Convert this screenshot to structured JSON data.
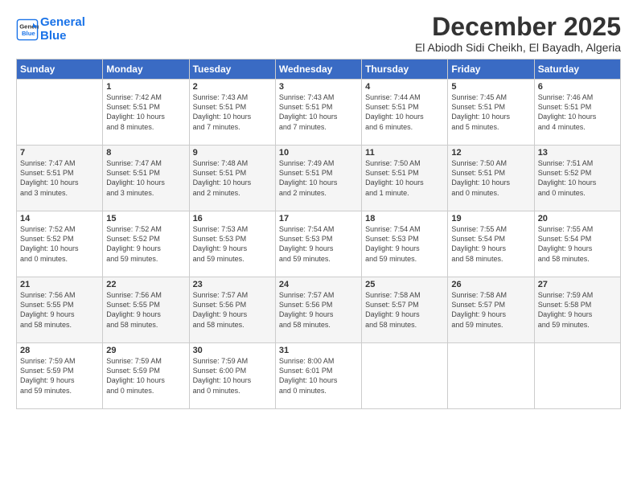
{
  "header": {
    "logo_line1": "General",
    "logo_line2": "Blue",
    "month_title": "December 2025",
    "location": "El Abiodh Sidi Cheikh, El Bayadh, Algeria"
  },
  "weekdays": [
    "Sunday",
    "Monday",
    "Tuesday",
    "Wednesday",
    "Thursday",
    "Friday",
    "Saturday"
  ],
  "weeks": [
    [
      {
        "day": "",
        "info": ""
      },
      {
        "day": "1",
        "info": "Sunrise: 7:42 AM\nSunset: 5:51 PM\nDaylight: 10 hours\nand 8 minutes."
      },
      {
        "day": "2",
        "info": "Sunrise: 7:43 AM\nSunset: 5:51 PM\nDaylight: 10 hours\nand 7 minutes."
      },
      {
        "day": "3",
        "info": "Sunrise: 7:43 AM\nSunset: 5:51 PM\nDaylight: 10 hours\nand 7 minutes."
      },
      {
        "day": "4",
        "info": "Sunrise: 7:44 AM\nSunset: 5:51 PM\nDaylight: 10 hours\nand 6 minutes."
      },
      {
        "day": "5",
        "info": "Sunrise: 7:45 AM\nSunset: 5:51 PM\nDaylight: 10 hours\nand 5 minutes."
      },
      {
        "day": "6",
        "info": "Sunrise: 7:46 AM\nSunset: 5:51 PM\nDaylight: 10 hours\nand 4 minutes."
      }
    ],
    [
      {
        "day": "7",
        "info": "Sunrise: 7:47 AM\nSunset: 5:51 PM\nDaylight: 10 hours\nand 3 minutes."
      },
      {
        "day": "8",
        "info": "Sunrise: 7:47 AM\nSunset: 5:51 PM\nDaylight: 10 hours\nand 3 minutes."
      },
      {
        "day": "9",
        "info": "Sunrise: 7:48 AM\nSunset: 5:51 PM\nDaylight: 10 hours\nand 2 minutes."
      },
      {
        "day": "10",
        "info": "Sunrise: 7:49 AM\nSunset: 5:51 PM\nDaylight: 10 hours\nand 2 minutes."
      },
      {
        "day": "11",
        "info": "Sunrise: 7:50 AM\nSunset: 5:51 PM\nDaylight: 10 hours\nand 1 minute."
      },
      {
        "day": "12",
        "info": "Sunrise: 7:50 AM\nSunset: 5:51 PM\nDaylight: 10 hours\nand 0 minutes."
      },
      {
        "day": "13",
        "info": "Sunrise: 7:51 AM\nSunset: 5:52 PM\nDaylight: 10 hours\nand 0 minutes."
      }
    ],
    [
      {
        "day": "14",
        "info": "Sunrise: 7:52 AM\nSunset: 5:52 PM\nDaylight: 10 hours\nand 0 minutes."
      },
      {
        "day": "15",
        "info": "Sunrise: 7:52 AM\nSunset: 5:52 PM\nDaylight: 9 hours\nand 59 minutes."
      },
      {
        "day": "16",
        "info": "Sunrise: 7:53 AM\nSunset: 5:53 PM\nDaylight: 9 hours\nand 59 minutes."
      },
      {
        "day": "17",
        "info": "Sunrise: 7:54 AM\nSunset: 5:53 PM\nDaylight: 9 hours\nand 59 minutes."
      },
      {
        "day": "18",
        "info": "Sunrise: 7:54 AM\nSunset: 5:53 PM\nDaylight: 9 hours\nand 59 minutes."
      },
      {
        "day": "19",
        "info": "Sunrise: 7:55 AM\nSunset: 5:54 PM\nDaylight: 9 hours\nand 58 minutes."
      },
      {
        "day": "20",
        "info": "Sunrise: 7:55 AM\nSunset: 5:54 PM\nDaylight: 9 hours\nand 58 minutes."
      }
    ],
    [
      {
        "day": "21",
        "info": "Sunrise: 7:56 AM\nSunset: 5:55 PM\nDaylight: 9 hours\nand 58 minutes."
      },
      {
        "day": "22",
        "info": "Sunrise: 7:56 AM\nSunset: 5:55 PM\nDaylight: 9 hours\nand 58 minutes."
      },
      {
        "day": "23",
        "info": "Sunrise: 7:57 AM\nSunset: 5:56 PM\nDaylight: 9 hours\nand 58 minutes."
      },
      {
        "day": "24",
        "info": "Sunrise: 7:57 AM\nSunset: 5:56 PM\nDaylight: 9 hours\nand 58 minutes."
      },
      {
        "day": "25",
        "info": "Sunrise: 7:58 AM\nSunset: 5:57 PM\nDaylight: 9 hours\nand 58 minutes."
      },
      {
        "day": "26",
        "info": "Sunrise: 7:58 AM\nSunset: 5:57 PM\nDaylight: 9 hours\nand 59 minutes."
      },
      {
        "day": "27",
        "info": "Sunrise: 7:59 AM\nSunset: 5:58 PM\nDaylight: 9 hours\nand 59 minutes."
      }
    ],
    [
      {
        "day": "28",
        "info": "Sunrise: 7:59 AM\nSunset: 5:59 PM\nDaylight: 9 hours\nand 59 minutes."
      },
      {
        "day": "29",
        "info": "Sunrise: 7:59 AM\nSunset: 5:59 PM\nDaylight: 10 hours\nand 0 minutes."
      },
      {
        "day": "30",
        "info": "Sunrise: 7:59 AM\nSunset: 6:00 PM\nDaylight: 10 hours\nand 0 minutes."
      },
      {
        "day": "31",
        "info": "Sunrise: 8:00 AM\nSunset: 6:01 PM\nDaylight: 10 hours\nand 0 minutes."
      },
      {
        "day": "",
        "info": ""
      },
      {
        "day": "",
        "info": ""
      },
      {
        "day": "",
        "info": ""
      }
    ]
  ]
}
